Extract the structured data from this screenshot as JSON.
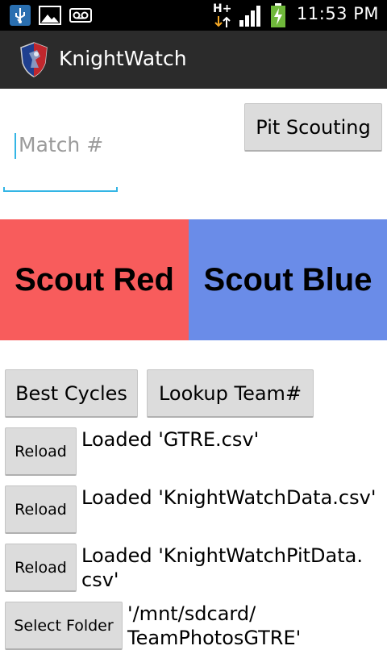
{
  "status_bar": {
    "time": "11:53 PM",
    "network_label": "H+"
  },
  "action_bar": {
    "title": "KnightWatch"
  },
  "match_field": {
    "placeholder": "Match #"
  },
  "buttons": {
    "pit_scouting": "Pit Scouting",
    "scout_red": "Scout Red",
    "scout_blue": "Scout Blue",
    "best_cycles": "Best Cycles",
    "lookup_team": "Lookup Team#",
    "reload": "Reload",
    "select_folder": "Select Folder"
  },
  "files": [
    {
      "status": "Loaded 'GTRE.csv'"
    },
    {
      "status": "Loaded 'KnightWatchData.csv'"
    },
    {
      "status": "Loaded 'KnightWatchPitData.\ncsv'"
    }
  ],
  "folder": {
    "path": "'/mnt/sdcard/\nTeamPhotosGTRE'"
  },
  "colors": {
    "red_team": "#f85c5c",
    "blue_team": "#6a8ce8",
    "accent": "#33b5e5"
  }
}
